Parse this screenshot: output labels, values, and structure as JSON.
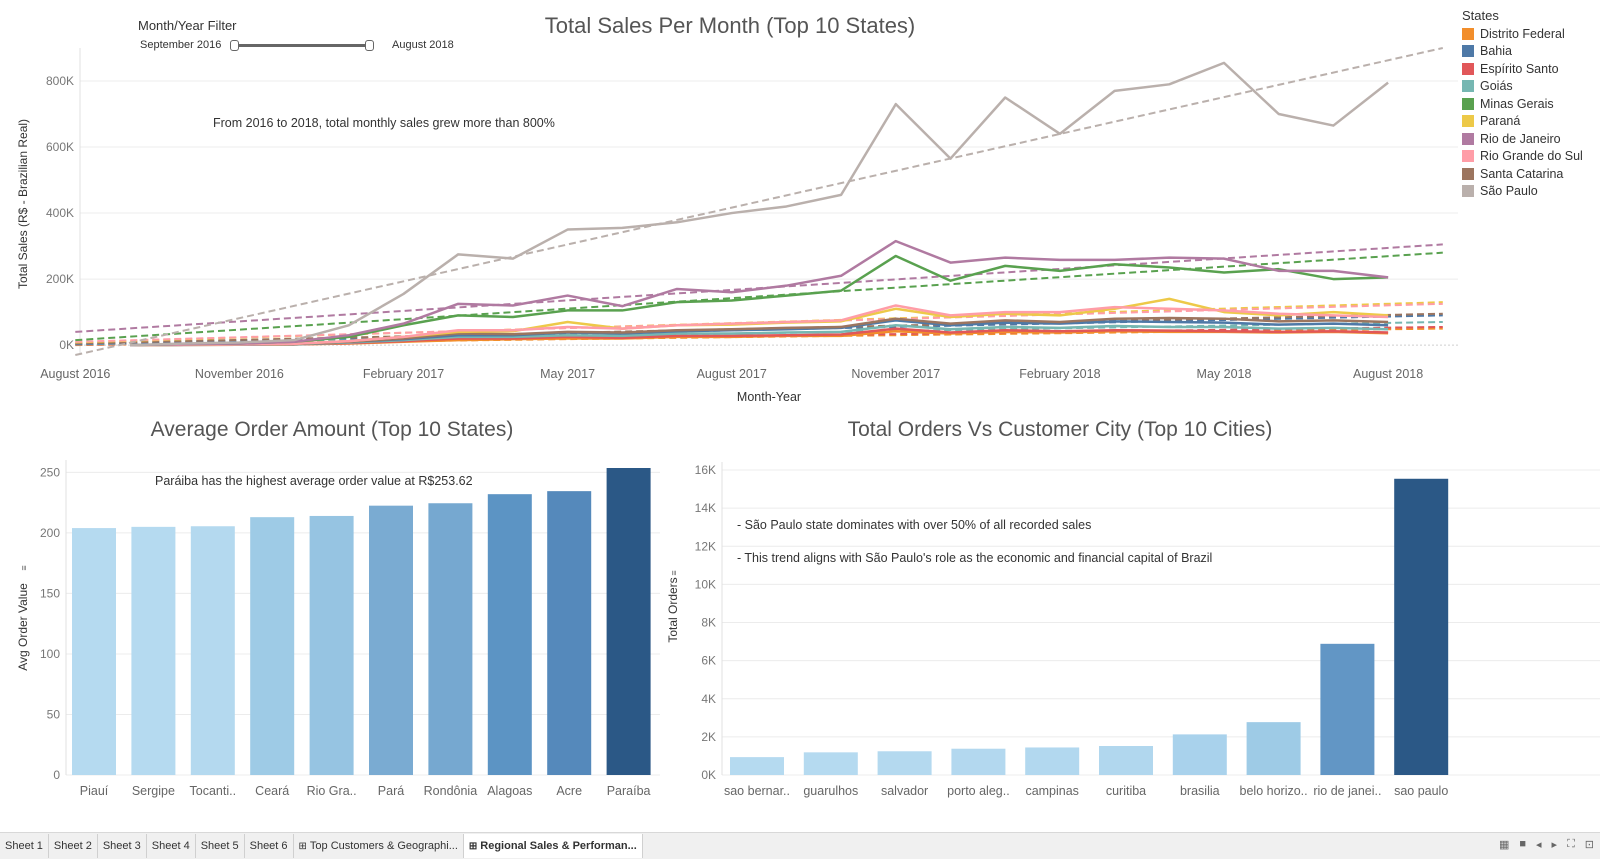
{
  "filter": {
    "title": "Month/Year Filter",
    "start_label": "September 2016",
    "end_label": "August 2018"
  },
  "legend": {
    "title": "States",
    "items": [
      {
        "name": "Distrito Federal",
        "color": "#f28e2b"
      },
      {
        "name": "Bahia",
        "color": "#4e79a7"
      },
      {
        "name": "Espírito Santo",
        "color": "#e15759"
      },
      {
        "name": "Goiás",
        "color": "#76b7b2"
      },
      {
        "name": "Minas Gerais",
        "color": "#59a14f"
      },
      {
        "name": "Paraná",
        "color": "#edc948"
      },
      {
        "name": "Rio de Janeiro",
        "color": "#b07aa1"
      },
      {
        "name": "Rio Grande do Sul",
        "color": "#ff9da7"
      },
      {
        "name": "Santa Catarina",
        "color": "#9c755f"
      },
      {
        "name": "São Paulo",
        "color": "#bab0ac"
      }
    ]
  },
  "tabs": [
    {
      "label": "Sheet 1",
      "icon": "",
      "active": false
    },
    {
      "label": "Sheet 2",
      "icon": "",
      "active": false
    },
    {
      "label": "Sheet 3",
      "icon": "",
      "active": false
    },
    {
      "label": "Sheet 4",
      "icon": "",
      "active": false
    },
    {
      "label": "Sheet 5",
      "icon": "",
      "active": false
    },
    {
      "label": "Sheet 6",
      "icon": "",
      "active": false
    },
    {
      "label": "Top Customers & Geographi...",
      "icon": "dashboard-icon",
      "active": false
    },
    {
      "label": "Regional Sales & Performan...",
      "icon": "dashboard-icon",
      "active": true
    }
  ],
  "chart_data": [
    {
      "type": "line",
      "title": "Total Sales Per Month (Top 10 States)",
      "xlabel": "Month-Year",
      "ylabel": "Total Sales (R$ - Brazilian Real)",
      "annotation": "From 2016 to 2018, total monthly sales grew more than 800%",
      "x_tick_labels": [
        "August 2016",
        "November 2016",
        "February 2017",
        "May 2017",
        "August 2017",
        "November 2017",
        "February 2018",
        "May 2018",
        "August 2018"
      ],
      "y_tick_labels": [
        "0K",
        "200K",
        "400K",
        "600K",
        "800K"
      ],
      "ylim": [
        -30000,
        900000
      ],
      "x": [
        "2016-09",
        "2016-10",
        "2016-11",
        "2016-12",
        "2017-01",
        "2017-02",
        "2017-03",
        "2017-04",
        "2017-05",
        "2017-06",
        "2017-07",
        "2017-08",
        "2017-09",
        "2017-10",
        "2017-11",
        "2017-12",
        "2018-01",
        "2018-02",
        "2018-03",
        "2018-04",
        "2018-05",
        "2018-06",
        "2018-07",
        "2018-08"
      ],
      "series": [
        {
          "name": "São Paulo",
          "color": "#bab0ac",
          "values": [
            0,
            5000,
            8000,
            15000,
            60000,
            155000,
            275000,
            262000,
            350000,
            355000,
            372000,
            400000,
            420000,
            455000,
            730000,
            565000,
            750000,
            640000,
            770000,
            790000,
            855000,
            700000,
            665000,
            795000
          ],
          "trend": [
            -30000,
            900000
          ]
        },
        {
          "name": "Rio de Janeiro",
          "color": "#b07aa1",
          "values": [
            0,
            3000,
            5000,
            10000,
            30000,
            65000,
            125000,
            120000,
            150000,
            118000,
            170000,
            160000,
            180000,
            210000,
            315000,
            250000,
            265000,
            258000,
            258000,
            265000,
            262000,
            225000,
            225000,
            205000
          ],
          "trend": [
            40000,
            305000
          ]
        },
        {
          "name": "Minas Gerais",
          "color": "#59a14f",
          "values": [
            0,
            3000,
            5000,
            10000,
            25000,
            60000,
            90000,
            85000,
            105000,
            105000,
            130000,
            135000,
            150000,
            165000,
            270000,
            195000,
            240000,
            225000,
            245000,
            235000,
            220000,
            230000,
            200000,
            205000
          ],
          "trend": [
            15000,
            280000
          ]
        },
        {
          "name": "Rio Grande do Sul",
          "color": "#ff9da7",
          "values": [
            0,
            1000,
            2000,
            4000,
            12000,
            25000,
            45000,
            45000,
            55000,
            50000,
            60000,
            65000,
            70000,
            75000,
            120000,
            90000,
            100000,
            100000,
            115000,
            110000,
            105000,
            95000,
            90000,
            85000
          ],
          "trend": [
            10000,
            125000
          ]
        },
        {
          "name": "Paraná",
          "color": "#edc948",
          "values": [
            0,
            1000,
            2000,
            4000,
            12000,
            25000,
            40000,
            42000,
            70000,
            50000,
            60000,
            62000,
            68000,
            72000,
            110000,
            85000,
            95000,
            90000,
            110000,
            140000,
            100000,
            90000,
            100000,
            90000
          ],
          "trend": [
            8000,
            130000
          ]
        },
        {
          "name": "Santa Catarina",
          "color": "#9c755f",
          "values": [
            0,
            1000,
            2000,
            3000,
            10000,
            20000,
            35000,
            33000,
            40000,
            38000,
            45000,
            48000,
            52000,
            55000,
            80000,
            65000,
            75000,
            70000,
            80000,
            82000,
            80000,
            72000,
            75000,
            70000
          ],
          "trend": [
            5000,
            95000
          ]
        },
        {
          "name": "Bahia",
          "color": "#4e79a7",
          "values": [
            0,
            1000,
            2000,
            3000,
            10000,
            18000,
            30000,
            30000,
            38000,
            35000,
            42000,
            45000,
            48000,
            52000,
            75000,
            60000,
            68000,
            65000,
            72000,
            70000,
            68000,
            62000,
            65000,
            60000
          ],
          "trend": [
            3000,
            90000
          ]
        },
        {
          "name": "Goiás",
          "color": "#76b7b2",
          "values": [
            0,
            500,
            1000,
            2000,
            8000,
            15000,
            25000,
            25000,
            30000,
            28000,
            35000,
            35000,
            38000,
            40000,
            60000,
            48000,
            55000,
            52000,
            58000,
            55000,
            55000,
            50000,
            52000,
            48000
          ],
          "trend": [
            2000,
            70000
          ]
        },
        {
          "name": "Espírito Santo",
          "color": "#e15759",
          "values": [
            0,
            500,
            1000,
            2000,
            6000,
            12000,
            20000,
            20000,
            25000,
            22000,
            28000,
            28000,
            30000,
            32000,
            50000,
            38000,
            45000,
            42000,
            45000,
            44000,
            42000,
            40000,
            42000,
            38000
          ],
          "trend": [
            1000,
            55000
          ]
        },
        {
          "name": "Distrito Federal",
          "color": "#f28e2b",
          "values": [
            0,
            500,
            1000,
            2000,
            5000,
            10000,
            15000,
            18000,
            20000,
            20000,
            25000,
            25000,
            28000,
            28000,
            42000,
            35000,
            40000,
            38000,
            42000,
            40000,
            40000,
            38000,
            40000,
            36000
          ],
          "trend": [
            0,
            50000
          ]
        }
      ]
    },
    {
      "type": "bar",
      "title": "Average Order Amount (Top 10 States)",
      "ylabel": "Avg Order Value",
      "annotation": "Paráiba has the highest average order value at R$253.62",
      "categories": [
        "Piauí",
        "Sergipe",
        "Tocanti..",
        "Ceará",
        "Rio Gra..",
        "Pará",
        "Rondônia",
        "Alagoas",
        "Acre",
        "Paraíba"
      ],
      "values": [
        204,
        205,
        205.5,
        213,
        214,
        222.5,
        224.5,
        232,
        234.5,
        253.62
      ],
      "colors": [
        "#b5daf0",
        "#b5daf0",
        "#b4d9ef",
        "#9ecbe6",
        "#96c4e2",
        "#7aabd2",
        "#76a8d0",
        "#5c94c4",
        "#5589bb",
        "#2b5886"
      ],
      "y_tick_labels": [
        "0",
        "50",
        "100",
        "150",
        "200",
        "250"
      ],
      "ylim": [
        0,
        253.62
      ]
    },
    {
      "type": "bar",
      "title": "Total Orders Vs Customer City (Top 10 Cities)",
      "ylabel": "Total Orders",
      "annotations": [
        "- São Paulo state dominates with over 50% of all recorded sales",
        "- This trend aligns with São Paulo's role as the economic and financial capital of Brazil"
      ],
      "categories": [
        "sao bernar..",
        "guarulhos",
        "salvador",
        "porto aleg..",
        "campinas",
        "curitiba",
        "brasilia",
        "belo horizo..",
        "rio de janei..",
        "sao paulo"
      ],
      "values": [
        938,
        1189,
        1245,
        1379,
        1444,
        1521,
        2131,
        2773,
        6882,
        15540
      ],
      "colors": [
        "#b5daf0",
        "#b5daf0",
        "#b4d9ef",
        "#b3d8ef",
        "#b2d8ef",
        "#b1d7ee",
        "#a9d2ec",
        "#9ecbe6",
        "#6296c5",
        "#2b5886"
      ],
      "y_tick_labels": [
        "0K",
        "2K",
        "4K",
        "6K",
        "8K",
        "10K",
        "12K",
        "14K",
        "16K"
      ],
      "ylim": [
        0,
        16000
      ]
    }
  ]
}
